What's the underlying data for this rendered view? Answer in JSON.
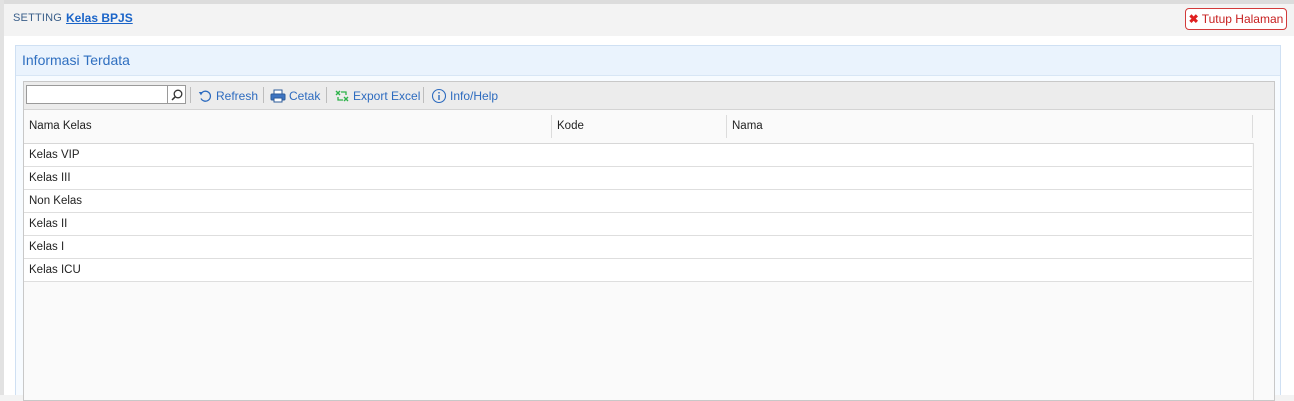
{
  "breadcrumb": {
    "section": "SETTING",
    "page": "Kelas BPJS"
  },
  "close_button": {
    "label": "Tutup Halaman"
  },
  "panel": {
    "title": "Informasi Terdata"
  },
  "toolbar": {
    "search_value": "",
    "refresh_label": "Refresh",
    "print_label": "Cetak",
    "export_label": "Export Excel",
    "help_label": "Info/Help"
  },
  "table": {
    "columns": [
      "Nama Kelas",
      "Kode",
      "Nama"
    ],
    "rows": [
      {
        "nama_kelas": "Kelas VIP",
        "kode": "",
        "nama": ""
      },
      {
        "nama_kelas": "Kelas III",
        "kode": "",
        "nama": ""
      },
      {
        "nama_kelas": "Non Kelas",
        "kode": "",
        "nama": ""
      },
      {
        "nama_kelas": "Kelas II",
        "kode": "",
        "nama": ""
      },
      {
        "nama_kelas": "Kelas I",
        "kode": "",
        "nama": ""
      },
      {
        "nama_kelas": "Kelas ICU",
        "kode": "",
        "nama": ""
      }
    ]
  },
  "colors": {
    "accent": "#2d6bbf",
    "close": "#d23a3a",
    "export_icon": "#2db34a"
  },
  "icons": [
    "search-icon",
    "refresh-icon",
    "printer-icon",
    "excel-export-icon",
    "info-icon",
    "close-x-icon"
  ]
}
